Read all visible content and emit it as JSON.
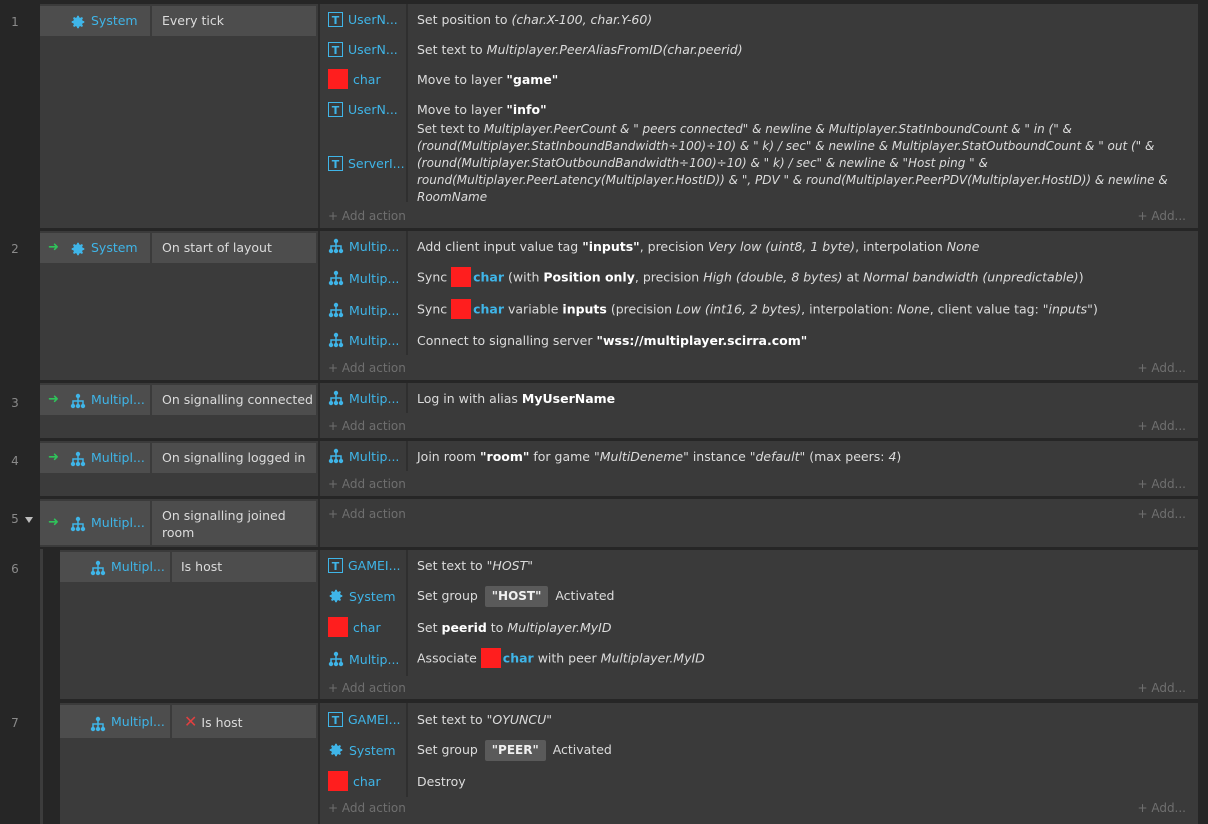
{
  "rows": {
    "r1": "1",
    "r2": "2",
    "r3": "3",
    "r4": "4",
    "r5": "5",
    "r6": "6",
    "r7": "7"
  },
  "add_action": "+ Add action",
  "add_more": "+ Add...",
  "ev1": {
    "cond_obj": "System",
    "cond_text": "Every tick",
    "a1_obj": "UserN...",
    "a1_pre": "Set position to ",
    "a1_expr": "(char.X-100, char.Y-60)",
    "a2_obj": "UserN...",
    "a2_pre": "Set text to ",
    "a2_expr": "Multiplayer.PeerAliasFromID(char.peerid)",
    "a3_obj": "char",
    "a3_pre": "Move to layer ",
    "a3_val": "\"game\"",
    "a4_obj": "UserN...",
    "a4_pre": "Move to layer ",
    "a4_val": "\"info\"",
    "a5_obj": "ServerI...",
    "a5_pre": "Set text to ",
    "a5_expr": "Multiplayer.PeerCount & \" peers connected\" & newline & Multiplayer.StatInboundCount & \" in (\" & (round(Multiplayer.StatInboundBandwidth÷100)÷10) & \" k) / sec\" & newline & Multiplayer.StatOutboundCount & \" out (\" & (round(Multiplayer.StatOutboundBandwidth÷100)÷10) & \" k) / sec\" & newline & \"Host ping \" & round(Multiplayer.PeerLatency(Multiplayer.HostID)) & \", PDV \" & round(Multiplayer.PeerPDV(Multiplayer.HostID)) & newline & RoomName"
  },
  "ev2": {
    "cond_obj": "System",
    "cond_text": "On start of layout",
    "a1_obj": "Multip...",
    "a1_p1": "Add client input value tag ",
    "a1_v1": "\"inputs\"",
    "a1_p2": ", precision ",
    "a1_v2": "Very low (uint8, 1 byte)",
    "a1_p3": ", interpolation ",
    "a1_v3": "None",
    "a2_obj": "Multip...",
    "a2_p1": "Sync ",
    "a2_ref": "char",
    "a2_p2": " (with ",
    "a2_v1": "Position only",
    "a2_p3": ", precision ",
    "a2_v2": "High (double, 8 bytes)",
    "a2_p4": " at ",
    "a2_v3": "Normal bandwidth (unpredictable)",
    "a2_p5": ")",
    "a3_obj": "Multip...",
    "a3_p1": "Sync ",
    "a3_ref": "char",
    "a3_p2": " variable ",
    "a3_v1": "inputs",
    "a3_p3": " (precision ",
    "a3_v2": "Low (int16, 2 bytes)",
    "a3_p4": ", interpolation: ",
    "a3_v3": "None",
    "a3_p5": ", client value tag: ",
    "a3_v4": "\"inputs\"",
    "a3_p6": ")",
    "a4_obj": "Multip...",
    "a4_pre": "Connect to signalling server ",
    "a4_val": "\"wss://multiplayer.scirra.com\""
  },
  "ev3": {
    "cond_obj": "Multipl...",
    "cond_text": "On signalling connected",
    "a1_obj": "Multip...",
    "a1_pre": "Log in with alias ",
    "a1_val": "MyUserName"
  },
  "ev4": {
    "cond_obj": "Multipl...",
    "cond_text": "On signalling logged in",
    "a1_obj": "Multip...",
    "a1_p1": "Join room ",
    "a1_v1": "\"room\"",
    "a1_p2": " for game ",
    "a1_v2": "\"MultiDeneme\"",
    "a1_p3": " instance ",
    "a1_v3": "\"default\"",
    "a1_p4": " (max peers: ",
    "a1_v4": "4",
    "a1_p5": ")"
  },
  "ev5": {
    "cond_obj": "Multipl...",
    "cond_line1": "On signalling joined",
    "cond_line2": "room"
  },
  "ev6": {
    "cond_obj": "Multipl...",
    "cond_text": "Is host",
    "a1_obj": "GAMEI...",
    "a1_pre": "Set text to ",
    "a1_val": "\"HOST\"",
    "a2_obj": "System",
    "a2_pre": "Set group ",
    "a2_badge": "\"HOST\"",
    "a2_post": " Activated",
    "a3_obj": "char",
    "a3_p1": "Set ",
    "a3_v1": "peerid",
    "a3_p2": " to ",
    "a3_v2": "Multiplayer.MyID",
    "a4_obj": "Multip...",
    "a4_p1": "Associate ",
    "a4_ref": "char",
    "a4_p2": " with peer ",
    "a4_v1": "Multiplayer.MyID"
  },
  "ev7": {
    "cond_obj": "Multipl...",
    "cond_text": "Is host",
    "a1_obj": "GAMEI...",
    "a1_pre": "Set text to ",
    "a1_val": "\"OYUNCU\"",
    "a2_obj": "System",
    "a2_pre": "Set group ",
    "a2_badge": "\"PEER\"",
    "a2_post": " Activated",
    "a3_obj": "char",
    "a3_text": "Destroy"
  },
  "colors": {
    "accent": "#3fb5e8",
    "trigger": "#2fc35a",
    "invert": "#e04040",
    "sprite": "#ff1e1e",
    "background": "#262626"
  }
}
